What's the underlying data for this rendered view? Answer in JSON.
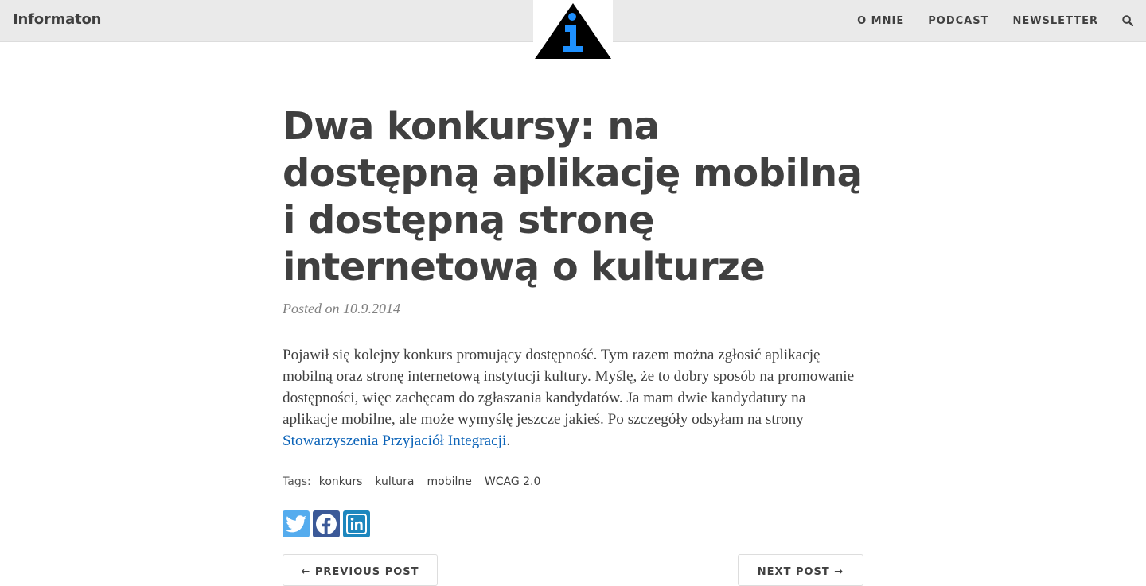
{
  "header": {
    "brand": "Informaton",
    "nav": [
      "O MNIE",
      "PODCAST",
      "NEWSLETTER"
    ],
    "search_icon": "search-icon"
  },
  "logo": {
    "icon": "info-triangle-logo",
    "colors": {
      "triangle": "#000000",
      "glyph": "#1e90ff"
    }
  },
  "post": {
    "title": "Dwa konkursy: na dostępną aplikację mobilną i dostępną stronę internetową o kulturze",
    "meta": "Posted on 10.9.2014",
    "body_text": "Pojawił się kolejny konkurs promujący dostępność. Tym razem można zgłosić aplikację mobilną oraz stronę internetową instytucji kultury. Myślę, że to dobry sposób na promowanie dostępności, więc zachęcam do zgłaszania kandydatów. Ja mam dwie kandydatury na aplikacje mobilne, ale może wymyślę jeszcze jakieś. Po szczegóły odsyłam na strony ",
    "body_link": "Stowarzyszenia Przyjaciół Integracji",
    "body_end": ".",
    "tags_label": "Tags:",
    "tags": [
      "konkurs",
      "kultura",
      "mobilne",
      "WCAG 2.0"
    ]
  },
  "share": {
    "icons": [
      "twitter-icon",
      "facebook-icon",
      "linkedin-icon"
    ],
    "colors": {
      "twitter": "#55acee",
      "facebook": "#3b5998",
      "linkedin": "#1d87be"
    }
  },
  "pager": {
    "prev": "← PREVIOUS POST",
    "next": "NEXT POST →"
  },
  "colors": {
    "link": "#0b63b8",
    "text": "#404040",
    "navbar": "#eaeaea"
  }
}
